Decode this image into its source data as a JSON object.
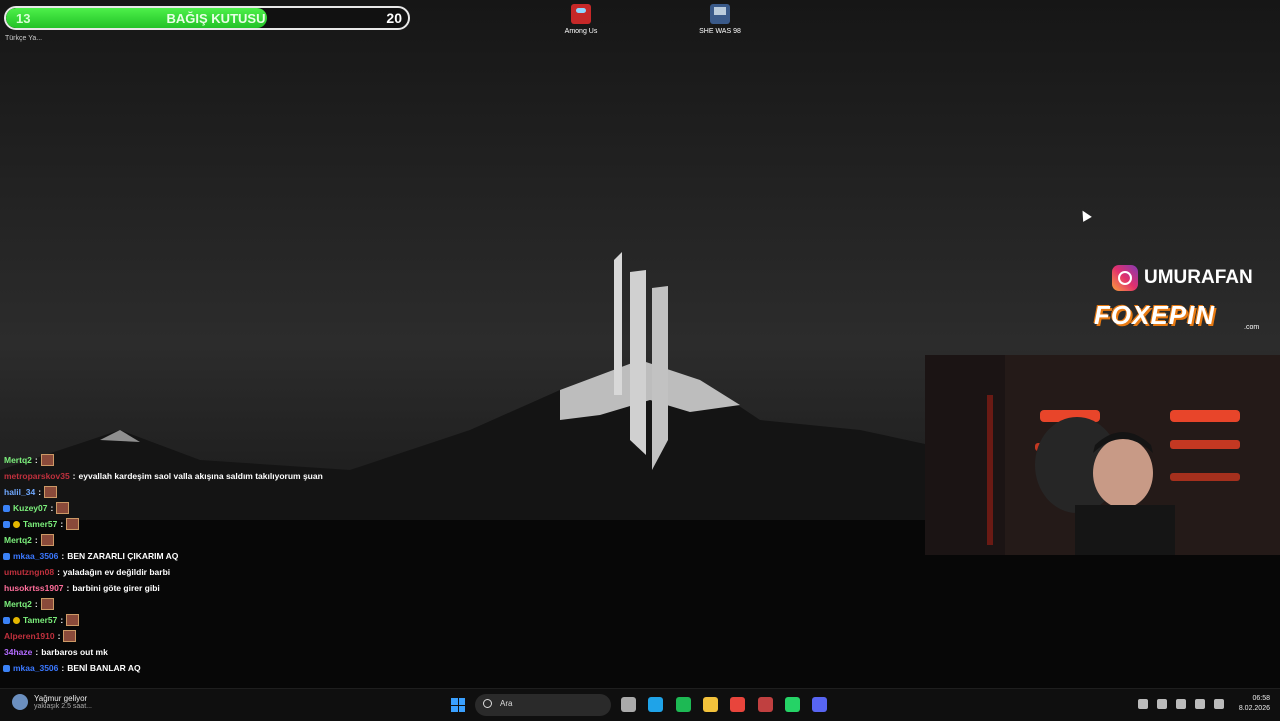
{
  "donation": {
    "current": "13",
    "title": "BAĞIŞ KUTUSU",
    "goal": "20",
    "progress": 0.65
  },
  "stream_language": "Türkçe Ya...",
  "desktop_icons": [
    {
      "label": "Among Us",
      "icon": "among-us-icon"
    },
    {
      "label": "SHE WAS 98",
      "icon": "game-icon"
    }
  ],
  "social": {
    "instagram": "UMURAFAN",
    "sponsor": "FOXEPIN",
    "sponsor_suffix": ".com"
  },
  "chat": [
    {
      "user": "Mertq2",
      "color": "#7cf07c",
      "badge": false,
      "coin": false,
      "message": "",
      "emote": true
    },
    {
      "user": "metroparskov35",
      "color": "#c0303d",
      "badge": false,
      "coin": false,
      "message": "eyvallah kardeşim saol valla akışına saldım takılıyorum şuan",
      "emote": false
    },
    {
      "user": "halil_34",
      "color": "#6fa8ff",
      "badge": false,
      "coin": false,
      "message": "",
      "emote": true
    },
    {
      "user": "Kuzey07",
      "color": "#7cf07c",
      "badge": true,
      "coin": false,
      "message": "",
      "emote": true
    },
    {
      "user": "Tamer57",
      "color": "#7cf07c",
      "badge": true,
      "coin": true,
      "message": "",
      "emote": true
    },
    {
      "user": "Mertq2",
      "color": "#7cf07c",
      "badge": false,
      "coin": false,
      "message": "",
      "emote": true
    },
    {
      "user": "mkaa_3506",
      "color": "#3b78ff",
      "badge": true,
      "coin": false,
      "message": "BEN ZARARLI ÇIKARIM AQ",
      "emote": false
    },
    {
      "user": "umutzngn08",
      "color": "#c0303d",
      "badge": false,
      "coin": false,
      "message": "yaladağın ev değildir barbi",
      "emote": false
    },
    {
      "user": "husokrtss1907",
      "color": "#ff6e9b",
      "badge": false,
      "coin": false,
      "message": "barbini göte girer gibi",
      "emote": false
    },
    {
      "user": "Mertq2",
      "color": "#7cf07c",
      "badge": false,
      "coin": false,
      "message": "",
      "emote": true
    },
    {
      "user": "Tamer57",
      "color": "#7cf07c",
      "badge": true,
      "coin": true,
      "message": "",
      "emote": true
    },
    {
      "user": "Alperen1910",
      "color": "#c0303d",
      "badge": false,
      "coin": false,
      "message": "",
      "emote": true
    },
    {
      "user": "34haze",
      "color": "#b36bff",
      "badge": false,
      "coin": false,
      "message": "barbaros out mk",
      "emote": false
    },
    {
      "user": "mkaa_3506",
      "color": "#3b78ff",
      "badge": true,
      "coin": false,
      "message": "BENİ BANLAR AQ",
      "emote": false
    }
  ],
  "taskbar": {
    "weather_title": "Yağmur geliyor",
    "weather_sub": "yaklaşık 2.5 saat...",
    "search_placeholder": "Ara",
    "apps": [
      {
        "name": "task-view-icon",
        "color": "#aaaaaa"
      },
      {
        "name": "edge-icon",
        "color": "#1fa3e8"
      },
      {
        "name": "spotify-icon",
        "color": "#1db954"
      },
      {
        "name": "file-explorer-icon",
        "color": "#f3c23b"
      },
      {
        "name": "chrome-icon",
        "color": "#e8453c"
      },
      {
        "name": "app-icon",
        "color": "#c04040"
      },
      {
        "name": "whatsapp-icon",
        "color": "#25d366"
      },
      {
        "name": "discord-icon",
        "color": "#5865f2"
      }
    ],
    "time": "06:58",
    "date": "8.02.2026"
  }
}
